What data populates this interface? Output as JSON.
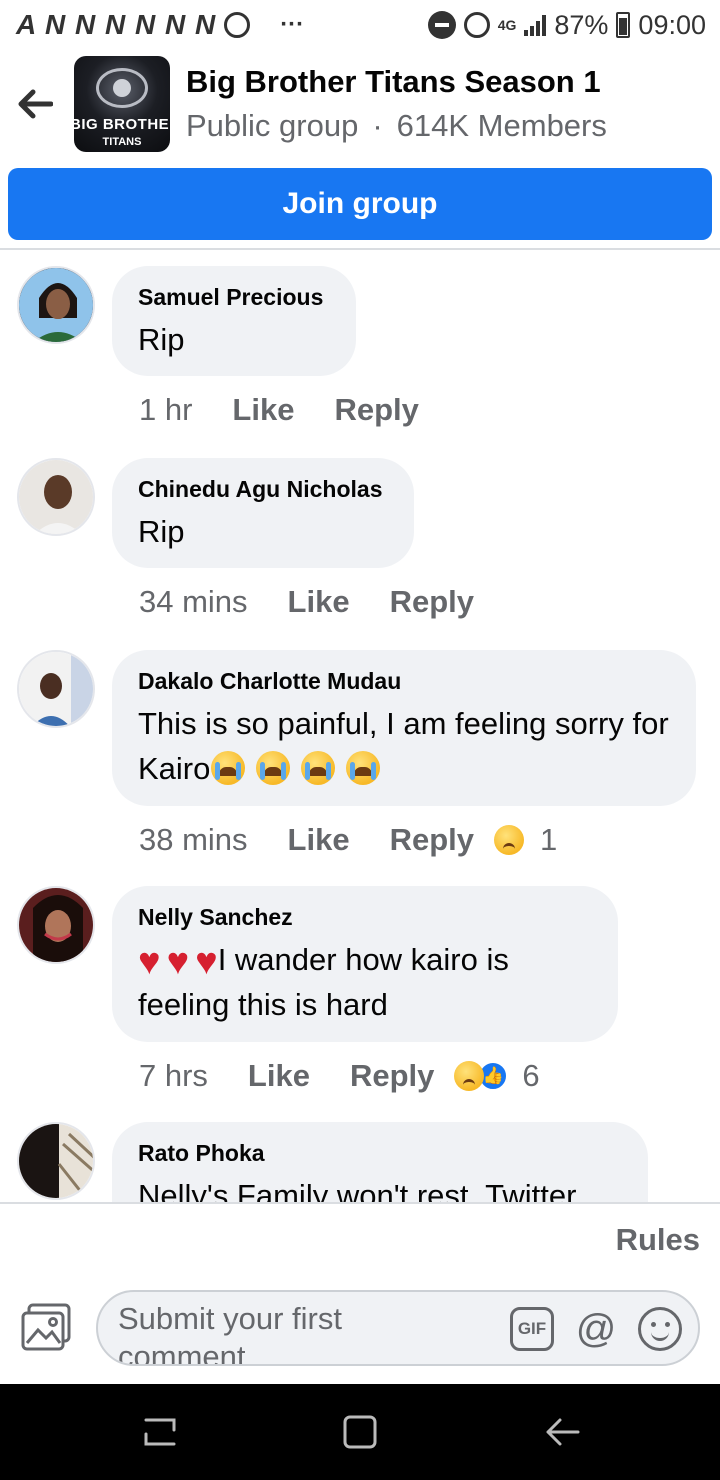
{
  "status_bar": {
    "left_icons": "A N N N N N N",
    "dots": "···",
    "network": "4G",
    "battery": "87%",
    "time": "09:00"
  },
  "header": {
    "title": "Big Brother Titans Season 1",
    "privacy": "Public group",
    "separator": "·",
    "members": "614K Members",
    "logo_text_1": "BIG BROTHER",
    "logo_text_2": "TITANS"
  },
  "join_button": "Join group",
  "comments": [
    {
      "author": "Samuel Precious",
      "text": "Rip",
      "time": "1 hr",
      "like": "Like",
      "reply": "Reply",
      "reaction_count": ""
    },
    {
      "author": "Chinedu Agu Nicholas",
      "text": "Rip",
      "time": "34 mins",
      "like": "Like",
      "reply": "Reply",
      "reaction_count": ""
    },
    {
      "author": "Dakalo Charlotte Mudau",
      "text": "This is so painful, I am feeling sorry for Kairo",
      "time": "38 mins",
      "like": "Like",
      "reply": "Reply",
      "reaction_count": "1"
    },
    {
      "author": "Nelly Sanchez",
      "text": "I wander how kairo is feeling this is hard",
      "time": "7 hrs",
      "like": "Like",
      "reply": "Reply",
      "reaction_count": "6"
    },
    {
      "author": "Rato Phoka",
      "text": "Nelly's Family won't rest. Twitter",
      "time": "",
      "like": "",
      "reply": "",
      "reaction_count": ""
    }
  ],
  "footer": {
    "rules": "Rules",
    "composer_placeholder": "Submit your first comment",
    "gif_label": "GIF",
    "at_label": "@"
  },
  "colors": {
    "accent": "#1877f2",
    "bubble": "#f0f2f5",
    "secondary_text": "#65676b"
  }
}
